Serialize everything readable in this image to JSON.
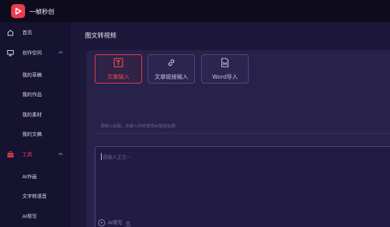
{
  "app": {
    "name": "一帧秒创",
    "brand_color": "#ee3b4d"
  },
  "sidebar": {
    "items": [
      {
        "label": "首页",
        "icon": "home-icon"
      },
      {
        "label": "创作空间",
        "icon": "monitor-icon",
        "expanded": true
      },
      {
        "label": "我的草稿"
      },
      {
        "label": "我的作品"
      },
      {
        "label": "我的素材"
      },
      {
        "label": "我的文稿"
      },
      {
        "label": "工具",
        "icon": "toolbox-icon",
        "expanded": true,
        "active": true
      },
      {
        "label": "AI作画"
      },
      {
        "label": "文字转语音"
      },
      {
        "label": "AI帮写"
      }
    ]
  },
  "main": {
    "title": "图文转视频",
    "tabs": [
      {
        "label": "文案输入",
        "icon": "text-t-icon",
        "active": true
      },
      {
        "label": "文章链接输入",
        "icon": "link-icon",
        "active": false
      },
      {
        "label": "Word导入",
        "icon": "word-doc-icon",
        "active": false
      }
    ],
    "title_input": {
      "placeholder": "请输入标题，未输入时将使用AI智能标题",
      "value": ""
    },
    "body_input": {
      "placeholder": "请输入正文···",
      "value": ""
    },
    "ai_help": {
      "label": "AI帮写",
      "icon": "ai-sparkle-icon"
    }
  }
}
